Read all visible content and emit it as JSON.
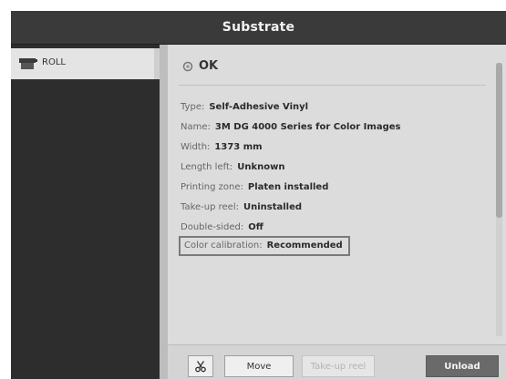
{
  "header": {
    "title": "Substrate"
  },
  "sidebar": {
    "items": [
      {
        "label": "ROLL",
        "icon": "roll-icon"
      }
    ]
  },
  "panel": {
    "status": {
      "text": "OK",
      "icon": "ok-icon"
    },
    "info": [
      {
        "label": "Type:",
        "value": "Self-Adhesive Vinyl"
      },
      {
        "label": "Name:",
        "value": "3M DG 4000 Series for Color Images"
      },
      {
        "label": "Width:",
        "value": "1373 mm"
      },
      {
        "label": "Length left:",
        "value": "Unknown"
      },
      {
        "label": "Printing zone:",
        "value": "Platen installed"
      },
      {
        "label": "Take-up reel:",
        "value": "Uninstalled"
      },
      {
        "label": "Double-sided:",
        "value": "Off"
      },
      {
        "label": "Color calibration:",
        "value": "Recommended"
      }
    ]
  },
  "toolbar": {
    "cut_icon": "scissors-icon",
    "move_label": "Move",
    "takeup_label": "Take-up reel",
    "unload_label": "Unload"
  }
}
